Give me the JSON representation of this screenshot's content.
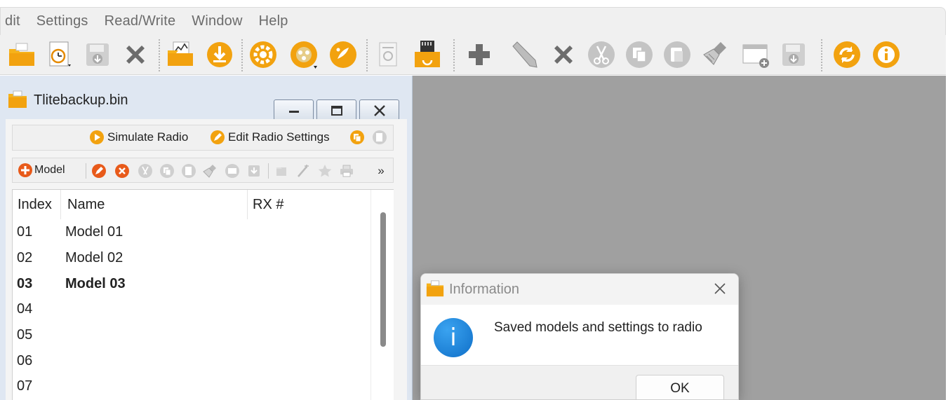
{
  "menu": [
    "dit",
    "Settings",
    "Read/Write",
    "Window",
    "Help"
  ],
  "toolbar": {
    "icons": [
      "open-folder-icon",
      "timer-icon",
      "save-disk-icon",
      "delete-x-icon",
      "chart-folder-icon",
      "download-icon",
      "gear-icon",
      "film-reel-icon",
      "palette-icon",
      "document-icon",
      "sd-card-folder-icon",
      "plus-icon",
      "pencil-icon",
      "close-x-icon",
      "scissors-icon",
      "copy-icon",
      "paste-icon",
      "brush-icon",
      "window-add-icon",
      "save-down-icon",
      "refresh-icon",
      "info-icon"
    ]
  },
  "colors": {
    "orange": "#f2a20f",
    "gray_icon": "#9a9a9a",
    "mdi_background": "#a0a0a0",
    "info_blue": "#1a7fd6"
  },
  "child_window": {
    "title": "Tlitebackup.bin",
    "radio_bar": {
      "simulate_label": "Simulate Radio",
      "edit_label": "Edit Radio Settings"
    },
    "model_bar": {
      "model_label": "Model",
      "more_label": "»"
    },
    "list": {
      "columns": [
        "Index",
        "Name",
        "RX #"
      ],
      "rows": [
        {
          "index": "01",
          "name": "Model 01"
        },
        {
          "index": "02",
          "name": "Model 02"
        },
        {
          "index": "03",
          "name": "Model 03"
        },
        {
          "index": "04",
          "name": ""
        },
        {
          "index": "05",
          "name": ""
        },
        {
          "index": "06",
          "name": ""
        },
        {
          "index": "07",
          "name": ""
        }
      ]
    }
  },
  "dialog": {
    "title": "Information",
    "message": "Saved models and settings to radio",
    "ok_label": "OK",
    "info_glyph": "i",
    "close_glyph": "✕"
  }
}
